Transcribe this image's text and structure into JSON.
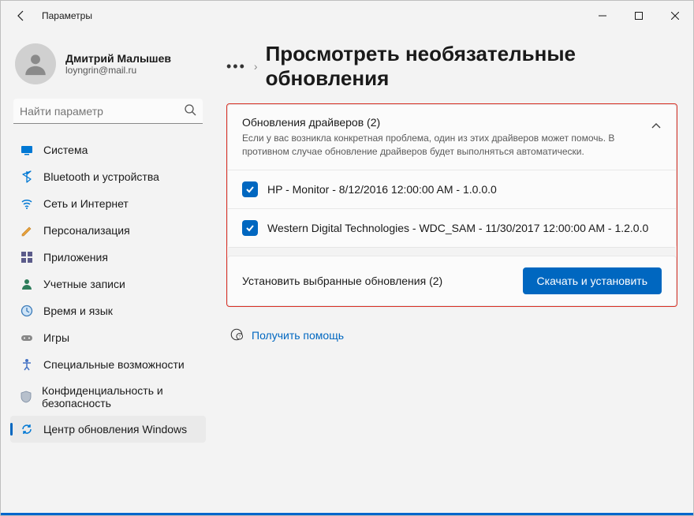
{
  "titlebar": {
    "title": "Параметры"
  },
  "account": {
    "name": "Дмитрий Малышев",
    "email": "loyngrin@mail.ru"
  },
  "search": {
    "placeholder": "Найти параметр"
  },
  "nav": {
    "items": [
      {
        "label": "Система",
        "icon": "system"
      },
      {
        "label": "Bluetooth и устройства",
        "icon": "bluetooth"
      },
      {
        "label": "Сеть и Интернет",
        "icon": "network"
      },
      {
        "label": "Персонализация",
        "icon": "personalization"
      },
      {
        "label": "Приложения",
        "icon": "apps"
      },
      {
        "label": "Учетные записи",
        "icon": "accounts"
      },
      {
        "label": "Время и язык",
        "icon": "time"
      },
      {
        "label": "Игры",
        "icon": "gaming"
      },
      {
        "label": "Специальные возможности",
        "icon": "accessibility"
      },
      {
        "label": "Конфиденциальность и безопасность",
        "icon": "privacy"
      },
      {
        "label": "Центр обновления Windows",
        "icon": "update"
      }
    ],
    "active_index": 10
  },
  "breadcrumb": {
    "page_title": "Просмотреть необязательные обновления"
  },
  "drivers_panel": {
    "title": "Обновления драйверов (2)",
    "subtitle": "Если у вас возникла конкретная проблема, один из этих драйверов может помочь. В противном случае обновление драйверов будет выполняться автоматически.",
    "items": [
      {
        "label": "HP - Monitor - 8/12/2016 12:00:00 AM - 1.0.0.0",
        "checked": true
      },
      {
        "label": "Western Digital Technologies - WDC_SAM - 11/30/2017 12:00:00 AM - 1.2.0.0",
        "checked": true
      }
    ]
  },
  "install_bar": {
    "summary": "Установить выбранные обновления (2)",
    "button": "Скачать и установить"
  },
  "help_link": {
    "label": "Получить помощь"
  }
}
